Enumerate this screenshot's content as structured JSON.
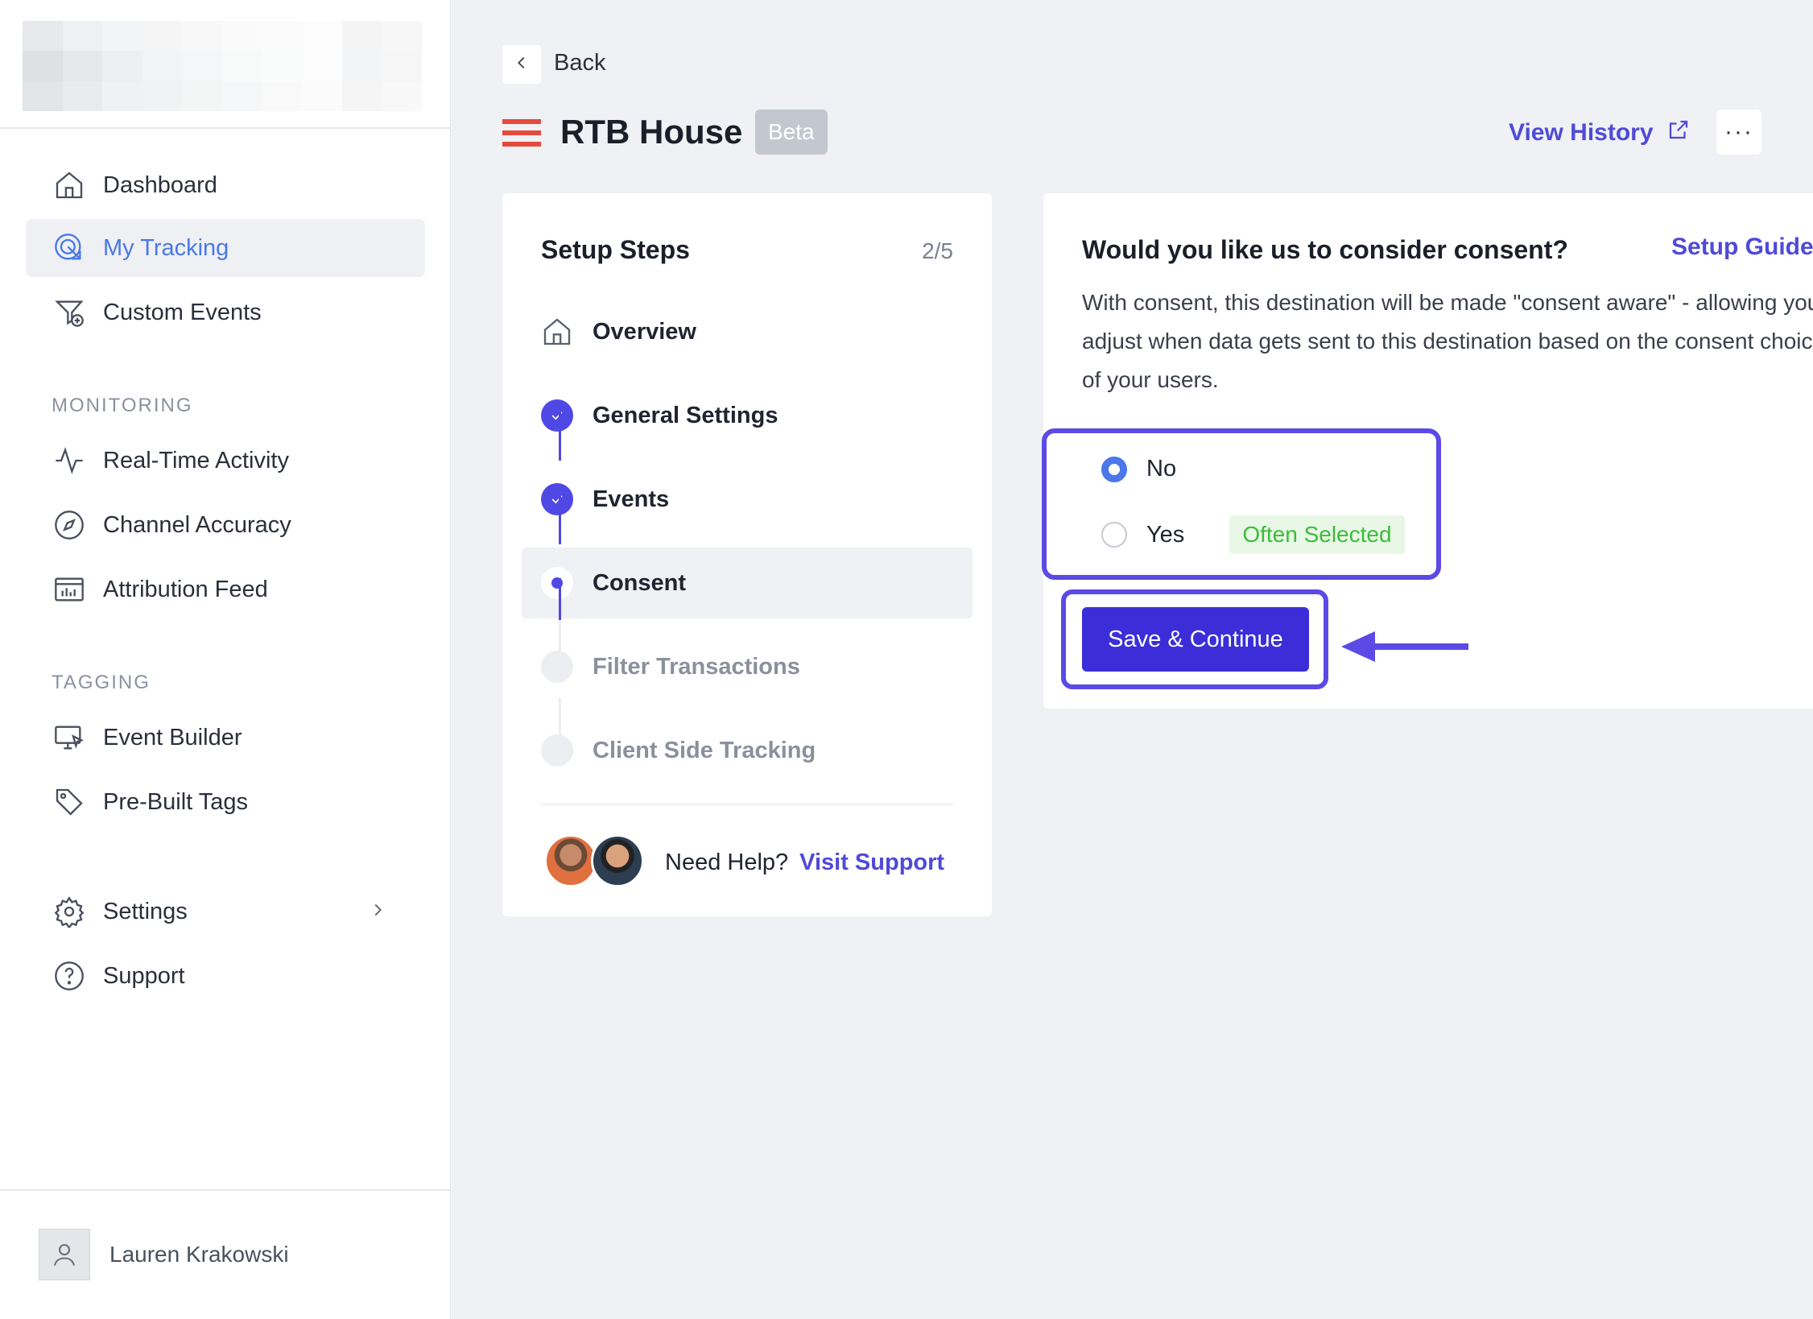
{
  "sidebar": {
    "nav_top": [
      {
        "label": "Dashboard",
        "icon": "home-icon"
      },
      {
        "label": "My Tracking",
        "icon": "target-cursor-icon",
        "active": true
      },
      {
        "label": "Custom Events",
        "icon": "filter-plus-icon"
      }
    ],
    "monitoring": {
      "title": "MONITORING",
      "items": [
        {
          "label": "Real-Time Activity",
          "icon": "activity-icon"
        },
        {
          "label": "Channel Accuracy",
          "icon": "compass-icon"
        },
        {
          "label": "Attribution Feed",
          "icon": "calendar-chart-icon"
        }
      ]
    },
    "tagging": {
      "title": "TAGGING",
      "items": [
        {
          "label": "Event Builder",
          "icon": "monitor-cursor-icon"
        },
        {
          "label": "Pre-Built Tags",
          "icon": "tag-icon"
        }
      ]
    },
    "bottom": [
      {
        "label": "Settings",
        "icon": "gear-icon"
      },
      {
        "label": "Support",
        "icon": "question-circle-icon"
      }
    ],
    "user": {
      "name": "Lauren Krakowski"
    }
  },
  "header": {
    "back_label": "Back",
    "title": "RTB House",
    "badge": "Beta",
    "view_history": "View History",
    "more": "···"
  },
  "steps": {
    "title": "Setup Steps",
    "count": "2/5",
    "items": [
      {
        "label": "Overview",
        "state": "home"
      },
      {
        "label": "General Settings",
        "state": "done"
      },
      {
        "label": "Events",
        "state": "done"
      },
      {
        "label": "Consent",
        "state": "current"
      },
      {
        "label": "Filter Transactions",
        "state": "future"
      },
      {
        "label": "Client Side Tracking",
        "state": "future"
      }
    ],
    "help_text": "Need Help?",
    "help_link": "Visit Support"
  },
  "consent": {
    "title": "Would you like us to consider consent?",
    "setup_guide": "Setup Guide",
    "description": "With consent, this destination will be made \"consent aware\" - allowing you to adjust when data gets sent to this destination based on the consent choices of your users.",
    "options": [
      {
        "label": "No",
        "checked": true
      },
      {
        "label": "Yes",
        "checked": false,
        "badge": "Often Selected"
      }
    ],
    "save_label": "Save & Continue"
  },
  "colors": {
    "accent": "#5048e5",
    "link": "#4f4ad8",
    "active_nav": "#4a78e8",
    "brand_red": "#e54a3c",
    "badge_green": "#3cbc3a"
  }
}
